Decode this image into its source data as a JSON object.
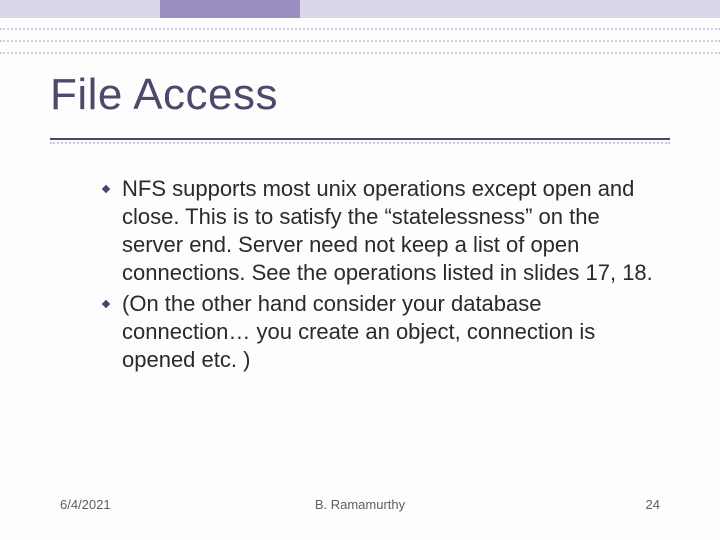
{
  "slide": {
    "title": "File Access",
    "bullets": [
      "NFS supports most unix operations except open and close. This is to satisfy the “statelessness” on the server end. Server need not keep a list of open connections. See the operations listed in slides 17, 18.",
      "(On the other hand consider your database connection… you create an object, connection is opened etc. )"
    ],
    "footer": {
      "date": "6/4/2021",
      "author": "B. Ramamurthy",
      "page": "24"
    }
  }
}
